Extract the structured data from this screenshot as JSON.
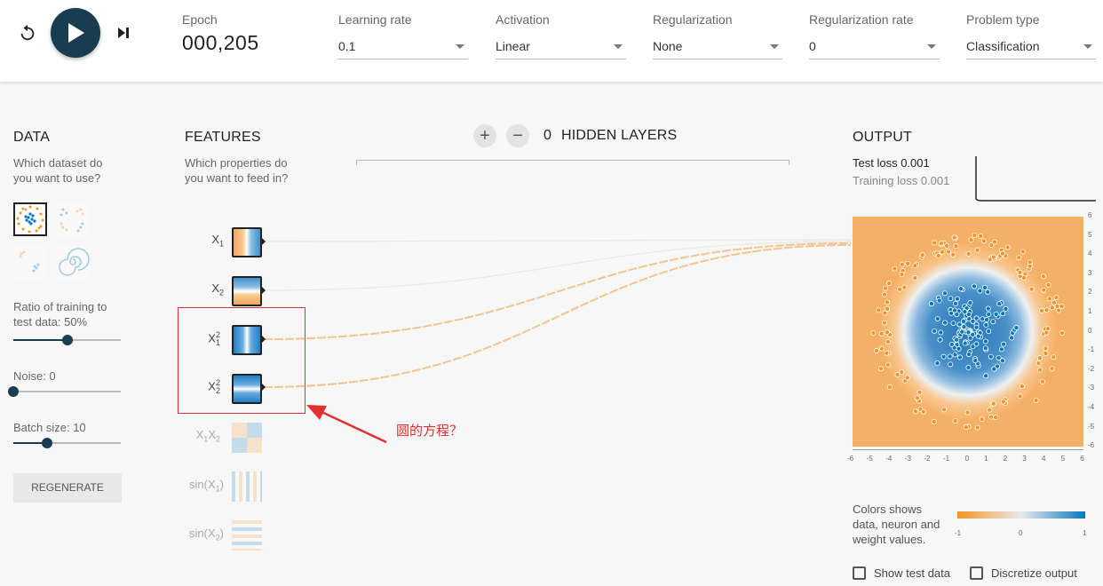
{
  "topbar": {
    "epoch_label": "Epoch",
    "epoch_value": "000,205",
    "learning_rate": {
      "label": "Learning rate",
      "value": "0.1"
    },
    "activation": {
      "label": "Activation",
      "value": "Linear"
    },
    "regularization": {
      "label": "Regularization",
      "value": "None"
    },
    "regularization_rate": {
      "label": "Regularization rate",
      "value": "0"
    },
    "problem_type": {
      "label": "Problem type",
      "value": "Classification"
    }
  },
  "data_panel": {
    "title": "DATA",
    "question_line1": "Which dataset do",
    "question_line2": "you want to use?",
    "ratio_label_line1": "Ratio of training to",
    "ratio_label_line2": "test data:  50%",
    "ratio_fraction": 0.5,
    "noise_label": "Noise:  0",
    "noise_fraction": 0.0,
    "batch_label": "Batch size:  10",
    "batch_fraction": 0.31,
    "regenerate_label": "REGENERATE"
  },
  "features_panel": {
    "title": "FEATURES",
    "question_line1": "Which properties do",
    "question_line2": "you want to feed in?",
    "features": [
      {
        "name": "X",
        "sub": "1",
        "sup": "",
        "active": true
      },
      {
        "name": "X",
        "sub": "2",
        "sup": "",
        "active": true
      },
      {
        "name": "X",
        "sub": "1",
        "sup": "2",
        "active": true
      },
      {
        "name": "X",
        "sub": "2",
        "sup": "2",
        "active": true
      },
      {
        "name": "X1X2",
        "active": false
      },
      {
        "name": "sin(X1)",
        "active": false
      },
      {
        "name": "sin(X2)",
        "active": false
      }
    ],
    "f5_a": "X",
    "f5_s1": "1",
    "f5_b": "X",
    "f5_s2": "2",
    "f6_a": "sin(X",
    "f6_s": "1",
    "f6_b": ")",
    "f7_a": "sin(X",
    "f7_s": "2",
    "f7_b": ")"
  },
  "hidden_layers": {
    "count": "0",
    "label": "HIDDEN LAYERS",
    "add_symbol": "+",
    "remove_symbol": "−"
  },
  "annotation": {
    "text": "圆的方程？",
    "color": "#e03030"
  },
  "output_panel": {
    "title": "OUTPUT",
    "test_loss_label": "Test loss",
    "test_loss_value": "0.001",
    "training_loss_label": "Training loss",
    "training_loss_value": "0.001",
    "y_ticks": [
      "6",
      "5",
      "4",
      "3",
      "2",
      "1",
      "0",
      "-1",
      "-2",
      "-3",
      "-4",
      "-5",
      "-6"
    ],
    "x_ticks": [
      "-6",
      "-5",
      "-4",
      "-3",
      "-2",
      "-1",
      "0",
      "1",
      "2",
      "3",
      "4",
      "5",
      "6"
    ],
    "legend_line1": "Colors shows",
    "legend_line2": "data, neuron and",
    "legend_line3": "weight values.",
    "legend_min": "-1",
    "legend_mid": "0",
    "legend_max": "1",
    "show_test_label": "Show test data",
    "discretize_label": "Discretize output"
  },
  "colors": {
    "orange": "#f59322",
    "blue": "#0877bd",
    "navy": "#183d4e"
  }
}
